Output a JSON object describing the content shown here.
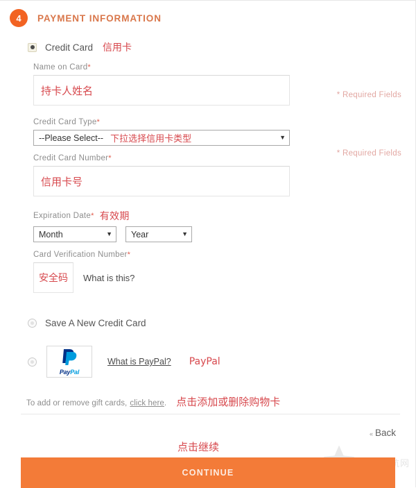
{
  "section": {
    "step_number": "4",
    "title": "PAYMENT INFORMATION"
  },
  "payment_methods": {
    "credit_card": {
      "label": "Credit Card",
      "annotation": "信用卡",
      "selected": true
    },
    "save_new_card": {
      "label": "Save A New Credit Card",
      "selected": false
    },
    "paypal": {
      "wordmark_pay": "Pay",
      "wordmark_pal": "Pal",
      "link_label": "What is PayPal?",
      "annotation": "PayPal",
      "selected": false
    }
  },
  "required_fields_notes": [
    "* Required Fields",
    "* Required Fields"
  ],
  "fields": {
    "name_on_card": {
      "label": "Name on Card",
      "required_marker": "*",
      "value": "",
      "annotation": "持卡人姓名"
    },
    "card_type": {
      "label": "Credit Card Type",
      "required_marker": "*",
      "selected_option": "--Please Select--",
      "annotation": "下拉选择信用卡类型",
      "caret": "▼"
    },
    "card_number": {
      "label": "Credit Card Number",
      "required_marker": "*",
      "value": "",
      "annotation": "信用卡号"
    },
    "expiration_date": {
      "label": "Expiration Date",
      "required_marker": "*",
      "annotation": "有效期",
      "month_selected": "Month",
      "year_selected": "Year",
      "caret": "▼"
    },
    "cvn": {
      "label": "Card Verification Number",
      "required_marker": "*",
      "value": "",
      "annotation": "安全码",
      "help_link": "What is this?"
    }
  },
  "gift_cards": {
    "text_prefix": "To add or remove gift cards,",
    "link_label": "click here",
    "text_suffix": ".",
    "annotation": "点击添加或删除购物卡"
  },
  "footer": {
    "back_label": "Back",
    "back_caret": "«",
    "continue_label": "CONTINUE",
    "continue_annotation": "点击继续"
  },
  "watermark": {
    "star": "★",
    "text": "中国起航网"
  },
  "colors": {
    "brand_orange": "#f26322",
    "button_orange": "#f37b38",
    "annotation_red": "#d7484d",
    "title_color": "#d9774b",
    "label_gray": "#8d8d8d"
  }
}
